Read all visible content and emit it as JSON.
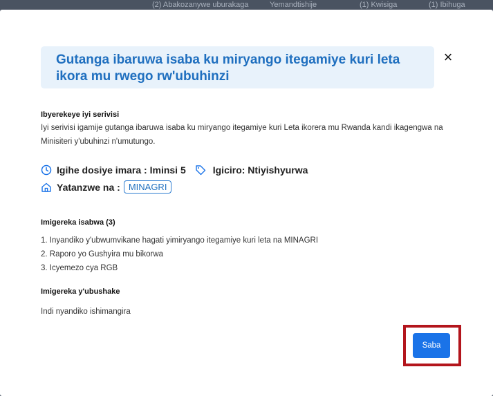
{
  "background_tabs": [
    "(2) Abakozanywe uburakaga",
    "Yemandtishije",
    "(1) Kwisiga",
    "(1) Ibihuga"
  ],
  "modal": {
    "title": "Gutanga ibaruwa isaba ku miryango itegamiye kuri leta ikora mu rwego rw'ubuhinzi",
    "close_label": "×"
  },
  "about": {
    "heading": "Ibyerekeye iyi serivisi",
    "description": "Iyi serivisi igamije gutanga ibaruwa isaba ku miryango itegamiye kuri Leta ikorera mu Rwanda kandi ikagengwa na Minisiteri y'ubuhinzi n'umutungo."
  },
  "meta": {
    "duration": "Igihe dosiye imara : Iminsi 5",
    "price": "Igiciro: Ntiyishyurwa",
    "provider_label": "Yatanzwe na :",
    "provider": "MINAGRI"
  },
  "required_docs": {
    "heading": "Imigereka isabwa (3)",
    "items": [
      "1. Inyandiko y'ubwumvikane hagati yimiryango itegamiye kuri leta na MINAGRI",
      "2. Raporo yo Gushyira mu bikorwa",
      "3. Icyemezo cya RGB"
    ]
  },
  "optional_docs": {
    "heading": "Imigereka y'ubushake",
    "text": "Indi nyandiko ishimangira"
  },
  "actions": {
    "submit_label": "Saba"
  },
  "colors": {
    "accent": "#1a73e8",
    "title": "#1f6fbf",
    "title_bg": "#e8f2fb",
    "highlight": "#b3151c"
  }
}
